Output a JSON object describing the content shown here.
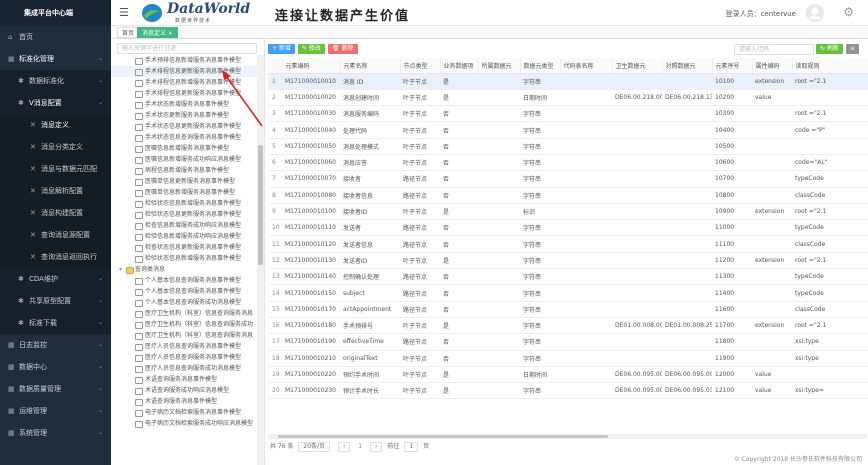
{
  "app_title": "集成平台中心端",
  "sidebar": [
    {
      "label": "首页",
      "icon": "home-icon",
      "level": 1,
      "chev": false
    },
    {
      "label": "标准化管理",
      "icon": "grid-icon",
      "level": 1,
      "chev": true,
      "active": true
    },
    {
      "label": "数据标准化",
      "icon": "gear-icon",
      "level": 2,
      "chev": true
    },
    {
      "label": "V消息配置",
      "icon": "gear-icon",
      "level": 2,
      "chev": true,
      "active": true
    },
    {
      "label": "消息定义",
      "icon": "dot-icon",
      "level": 3,
      "chev": false,
      "active": true
    },
    {
      "label": "消息分类定义",
      "icon": "dot-icon",
      "level": 3,
      "chev": false
    },
    {
      "label": "消息与数据元匹配",
      "icon": "dot-icon",
      "level": 3,
      "chev": false
    },
    {
      "label": "消息解析配置",
      "icon": "dot-icon",
      "level": 3,
      "chev": false
    },
    {
      "label": "消息构建配置",
      "icon": "dot-icon",
      "level": 3,
      "chev": false
    },
    {
      "label": "查询消息源配置",
      "icon": "dot-icon",
      "level": 3,
      "chev": false
    },
    {
      "label": "查询消息返回执行",
      "icon": "dot-icon",
      "level": 3,
      "chev": false
    },
    {
      "label": "CDA维护",
      "icon": "gear-icon",
      "level": 2,
      "chev": true
    },
    {
      "label": "共享原型配置",
      "icon": "gear-icon",
      "level": 2,
      "chev": true
    },
    {
      "label": "标准下载",
      "icon": "gear-icon",
      "level": 2,
      "chev": true
    },
    {
      "label": "日志监控",
      "icon": "grid-icon",
      "level": 1,
      "chev": true
    },
    {
      "label": "数据中心",
      "icon": "grid-icon",
      "level": 1,
      "chev": true
    },
    {
      "label": "数据质量管理",
      "icon": "grid-icon",
      "level": 1,
      "chev": true
    },
    {
      "label": "运维管理",
      "icon": "grid-icon",
      "level": 1,
      "chev": true
    },
    {
      "label": "系统管理",
      "icon": "grid-icon",
      "level": 1,
      "chev": true
    }
  ],
  "header": {
    "brand": "DataWorld",
    "brand_sub": "数据世界技术",
    "slogan": "连接让数据产生价值",
    "user_label": "登录人员：centervue"
  },
  "tabs": [
    {
      "label": "首页",
      "on": false
    },
    {
      "label": "消息定义 ×",
      "on": true
    }
  ],
  "tree": {
    "search_placeholder": "输入关键字进行过滤",
    "nodes": [
      {
        "t": "手术预排信息新增服务消息事件模型",
        "sel": false
      },
      {
        "t": "手术排程信息更新服务消息事件模型",
        "sel": true
      },
      {
        "t": "手术排程信息新增服务消息事件模型",
        "sel": false
      },
      {
        "t": "手术排程信息更新服务消息事件模型",
        "sel": false
      },
      {
        "t": "手术状态新增服务消息事件模型",
        "sel": false
      },
      {
        "t": "手术状态更新服务消息事件模型",
        "sel": false
      },
      {
        "t": "手术状态信息更新服务消息事件模型",
        "sel": false
      },
      {
        "t": "手术状态信息查询服务消息事件模型",
        "sel": false
      },
      {
        "t": "医嘱信息新增服务消息事件模型",
        "sel": false
      },
      {
        "t": "医嘱信息新增服务成功响应消息模型",
        "sel": false
      },
      {
        "t": "病程信息新增服务消息事件模型",
        "sel": false
      },
      {
        "t": "医嘱单信息更新服务消息事件模型",
        "sel": false
      },
      {
        "t": "医嘱单信息新增服务消息事件模型",
        "sel": false
      },
      {
        "t": "检验状态信息新增服务消息事件模型",
        "sel": false
      },
      {
        "t": "检验状态信息更新服务消息事件模型",
        "sel": false
      },
      {
        "t": "检查信息新增服务成功响应消息模型",
        "sel": false
      },
      {
        "t": "检验信息新增服务成功响应消息模型",
        "sel": false
      },
      {
        "t": "检查状态信息更新服务消息事件模型",
        "sel": false
      },
      {
        "t": "检验状态信息新增服务消息事件模型",
        "sel": false
      },
      {
        "t": "查询类消息",
        "sel": false,
        "fold": true
      },
      {
        "t": "个人基本信息查询服务消息事件模型",
        "sel": false
      },
      {
        "t": "个人基本信息查询服务消息事件模型",
        "sel": false
      },
      {
        "t": "个人基本信息查询服务成功消息模型",
        "sel": false
      },
      {
        "t": "医疗卫生机构（科室）信息查询服务消息",
        "sel": false
      },
      {
        "t": "医疗卫生机构（科室）信息查询服务成功",
        "sel": false
      },
      {
        "t": "医疗卫生机构（科室）信息查询服务消息",
        "sel": false
      },
      {
        "t": "医疗人员信息查询服务消息事件模型",
        "sel": false
      },
      {
        "t": "医疗人员信息查询服务消息事件模型",
        "sel": false
      },
      {
        "t": "医疗人员信息查询服务成功消息模型",
        "sel": false
      },
      {
        "t": "术语查询服务消息事件模型",
        "sel": false
      },
      {
        "t": "术语查询服务成功响应消息模型",
        "sel": false
      },
      {
        "t": "术语查询服务消息事件模型",
        "sel": false
      },
      {
        "t": "电子病历文档检索服务消息事件模型",
        "sel": false
      },
      {
        "t": "电子病历文档检索服务成功响应消息模型",
        "sel": false
      }
    ]
  },
  "toolbar": {
    "add": "+ 新增",
    "edit": "✎ 修改",
    "del": "🗑 删除",
    "search_placeholder": "请输入代码",
    "refresh": "↻ 刷新",
    "menu": "≡"
  },
  "colors": {
    "add": "#409eff",
    "edit": "#67c23a",
    "del": "#f56c6c",
    "refresh": "#67c23a",
    "menu": "#909399"
  },
  "table": {
    "headers": [
      "",
      "元素编码",
      "元素名称",
      "节点类型",
      "业务数据项",
      "所属数据元",
      "数据元类型",
      "代码表名称",
      "卫生数据元",
      "对照数据元",
      "元素序号",
      "属性编码",
      "读取规则"
    ],
    "rows": [
      [
        "1",
        "M171000010010",
        "消息 ID",
        "叶子节点",
        "是",
        "",
        "字符串",
        "",
        "",
        "",
        "10100",
        "extension",
        "root =\"2.1"
      ],
      [
        "2",
        "M171000010020",
        "消息创建时间",
        "叶子节点",
        "是",
        "",
        "日期时间",
        "",
        "DE06.00.218.00",
        "DE06.00.218.13",
        "10200",
        "value",
        ""
      ],
      [
        "3",
        "M171000010030",
        "消息服务编码",
        "叶子节点",
        "否",
        "",
        "字符串",
        "",
        "",
        "",
        "10300",
        "",
        "root =\"2.1"
      ],
      [
        "4",
        "M171000010040",
        "处理代码",
        "叶子节点",
        "否",
        "",
        "字符串",
        "",
        "",
        "",
        "10400",
        "",
        "code =\"P\""
      ],
      [
        "5",
        "M171000010050",
        "消息处理模式",
        "叶子节点",
        "否",
        "",
        "字符串",
        "",
        "",
        "",
        "10500",
        "",
        ""
      ],
      [
        "6",
        "M171000010060",
        "消息应答",
        "叶子节点",
        "否",
        "",
        "字符串",
        "",
        "",
        "",
        "10600",
        "",
        "code=\"AL\""
      ],
      [
        "7",
        "M171000010070",
        "接收者",
        "路径节点",
        "否",
        "",
        "字符串",
        "",
        "",
        "",
        "10700",
        "",
        "typeCode"
      ],
      [
        "8",
        "M171000010080",
        "接收者信息",
        "路径节点",
        "否",
        "",
        "字符串",
        "",
        "",
        "",
        "10800",
        "",
        "classCode"
      ],
      [
        "9",
        "M171000010100",
        "接收者ID",
        "叶子节点",
        "是",
        "",
        "标识",
        "",
        "",
        "",
        "10900",
        "extension",
        "root =\"2.1"
      ],
      [
        "10",
        "M171000010110",
        "发送者",
        "路径节点",
        "否",
        "",
        "字符串",
        "",
        "",
        "",
        "11000",
        "",
        "typeCode"
      ],
      [
        "11",
        "M171000010120",
        "发送者信息",
        "路径节点",
        "否",
        "",
        "字符串",
        "",
        "",
        "",
        "11100",
        "",
        "classCode"
      ],
      [
        "12",
        "M171000010130",
        "发送者ID",
        "叶子节点",
        "是",
        "",
        "字符串",
        "",
        "",
        "",
        "11200",
        "extension",
        "root =\"2.1"
      ],
      [
        "13",
        "M171000010140",
        "控制确认处理",
        "路径节点",
        "否",
        "",
        "字符串",
        "",
        "",
        "",
        "11300",
        "",
        "typeCode"
      ],
      [
        "14",
        "M171000010150",
        "subject",
        "路径节点",
        "否",
        "",
        "字符串",
        "",
        "",
        "",
        "11400",
        "",
        "typeCode"
      ],
      [
        "15",
        "M171000010170",
        "actAppointment",
        "路径节点",
        "否",
        "",
        "字符串",
        "",
        "",
        "",
        "11600",
        "",
        "classCode"
      ],
      [
        "16",
        "M171000010180",
        "手术预排号",
        "叶子节点",
        "是",
        "",
        "字符串",
        "",
        "DE01.00.008.00",
        "DE01.00.008.25",
        "11700",
        "extension",
        "root =\"2.1"
      ],
      [
        "17",
        "M171000010190",
        "effectiveTime",
        "路径节点",
        "否",
        "",
        "字符串",
        "",
        "",
        "",
        "11800",
        "",
        "xsi:type"
      ],
      [
        "18",
        "M171000010210",
        "originalText",
        "叶子节点",
        "否",
        "",
        "字符串",
        "",
        "",
        "",
        "11900",
        "",
        "xsi:type"
      ],
      [
        "19",
        "M171000010220",
        "预约手术时间",
        "叶子节点",
        "是",
        "",
        "日期时间",
        "",
        "DE06.00.095.00",
        "DE06.00.095.00",
        "12000",
        "value",
        ""
      ],
      [
        "20",
        "M171000010230",
        "预计手术时长",
        "叶子节点",
        "是",
        "",
        "字符串",
        "",
        "DE06.00.095.00",
        "DE06.00.095.03",
        "12100",
        "value",
        "xsi:type="
      ]
    ]
  },
  "pager": {
    "total": "共 76 条",
    "size": "20条/页",
    "prev": "‹",
    "next": "›",
    "goto": "前往",
    "page": "1",
    "page_suffix": "页"
  },
  "copyright": "© Copyright 2018 长沙参氏软件科技有限公司"
}
